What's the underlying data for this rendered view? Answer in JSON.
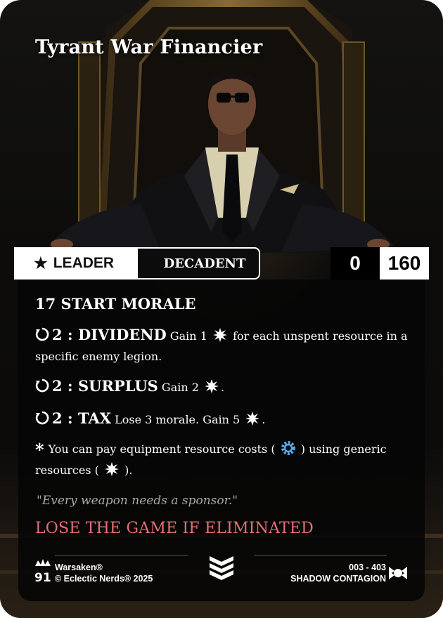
{
  "card": {
    "title": "Tyrant War Financier",
    "type_main": "LEADER",
    "type_sub": "DECADENT",
    "cost": "0",
    "points": "160",
    "start_morale": "17 START MORALE",
    "abilities": [
      {
        "head": "2 : DIVIDEND",
        "text_a": "Gain 1",
        "text_b": "for each unspent resource in a specific enemy legion."
      },
      {
        "head": "2 : SURPLUS",
        "text_a": "Gain 2",
        "text_b": "."
      },
      {
        "head": "2 : TAX",
        "text_a": "Lose 3 morale. Gain 5",
        "text_b": "."
      }
    ],
    "passive": {
      "text_a": "You can pay equipment resource costs (",
      "text_b": ") using generic resources (",
      "text_c": ")."
    },
    "flavor": "\"Every weapon needs a sponsor.\"",
    "warning": "LOSE THE GAME IF ELIMINATED"
  },
  "footer": {
    "brand": "Warsaken®",
    "copyright": "© Eclectic Nerds® 2025",
    "number": "003 - 403",
    "set": "SHADOW CONTAGION"
  },
  "colors": {
    "warning": "#e46e74",
    "gear_icon": "#59a8e6",
    "flavor": "#a8a8a8"
  },
  "icons": {
    "type_marker": "star-icon",
    "ability_cost": "rotate-icon",
    "generic_resource": "burst-icon",
    "equipment_resource": "gear-icon",
    "passive_marker": "asterisk-icon",
    "rarity": "chevron-stack-icon",
    "faction": "shadow-contagion-icon",
    "publisher": "crown-logo-icon"
  }
}
